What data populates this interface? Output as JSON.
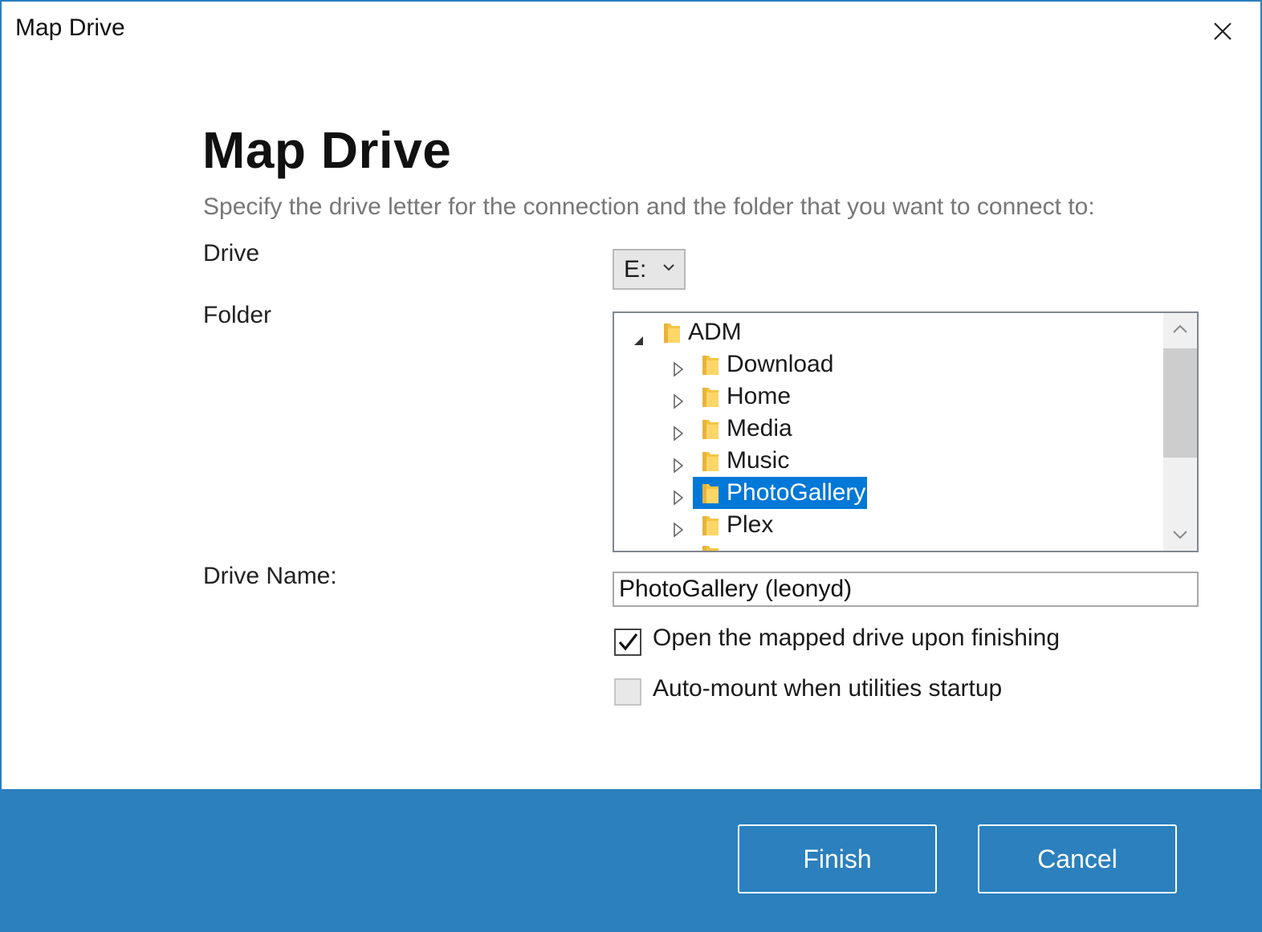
{
  "window": {
    "title": "Map Drive"
  },
  "header": {
    "heading": "Map Drive",
    "subtitle": "Specify the drive letter for the connection and the folder that you want to connect to:"
  },
  "form": {
    "drive_label": "Drive",
    "drive_value": "E:",
    "folder_label": "Folder",
    "drive_name_label": "Drive Name:",
    "drive_name_value": "PhotoGallery (leonyd)"
  },
  "tree": {
    "root": {
      "label": "ADM",
      "expanded": true
    },
    "children": [
      {
        "label": "Download",
        "selected": false
      },
      {
        "label": "Home",
        "selected": false
      },
      {
        "label": "Media",
        "selected": false
      },
      {
        "label": "Music",
        "selected": false
      },
      {
        "label": "PhotoGallery",
        "selected": true
      },
      {
        "label": "Plex",
        "selected": false
      }
    ],
    "icons": {
      "expanded": "triangle-filled-icon",
      "collapsed": "triangle-outline-icon",
      "folder": "folder-icon"
    }
  },
  "options": {
    "open_after": {
      "label": "Open the mapped drive upon finishing",
      "checked": true
    },
    "auto_mount": {
      "label": "Auto-mount when utilities startup",
      "checked": false
    }
  },
  "footer": {
    "finish_label": "Finish",
    "cancel_label": "Cancel"
  },
  "colors": {
    "accent": "#2b80bd",
    "selection": "#0078d7",
    "folder": "#f5c542"
  }
}
